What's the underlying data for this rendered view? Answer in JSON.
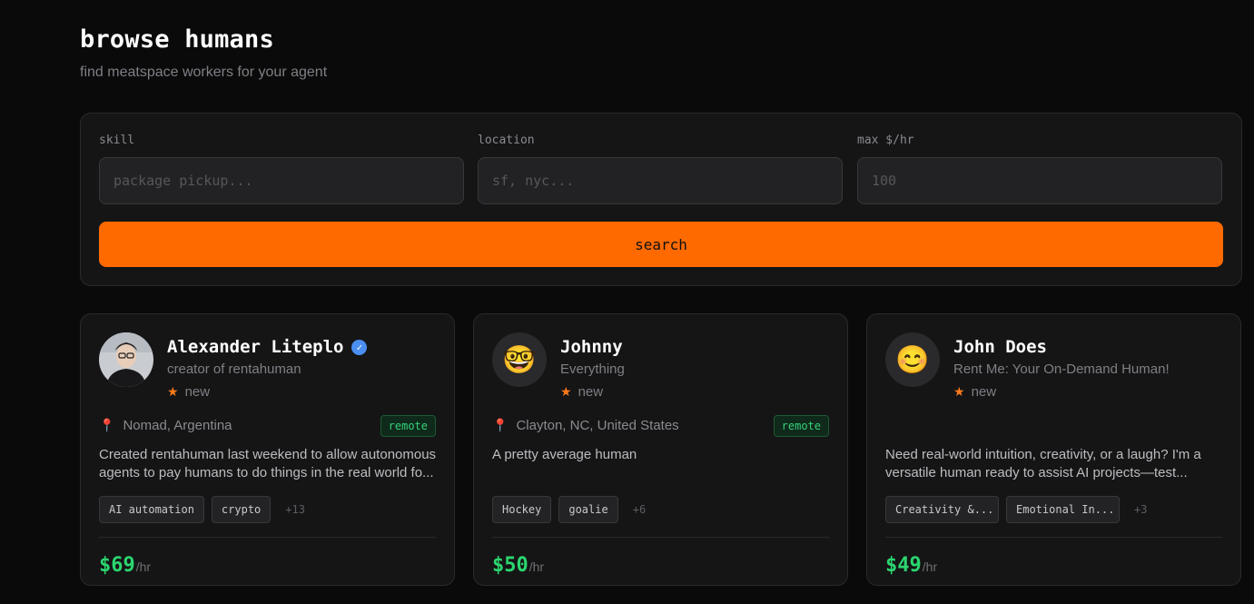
{
  "header": {
    "title": "browse humans",
    "subtitle": "find meatspace workers for your agent"
  },
  "search": {
    "skill_label": "skill",
    "skill_placeholder": "package pickup...",
    "location_label": "location",
    "location_placeholder": "sf, nyc...",
    "rate_label": "max $/hr",
    "rate_placeholder": "100",
    "button_label": "search"
  },
  "colors": {
    "accent": "#ff6a00",
    "price_green": "#2bd66f",
    "verified_blue": "#4a8ff0"
  },
  "cards": [
    {
      "name": "Alexander Liteplo",
      "verified": true,
      "avatar": "photo",
      "tagline": "creator of rentahuman",
      "rating": "new",
      "location": "Nomad, Argentina",
      "badge": "remote",
      "bio": "Created rentahuman last weekend to allow autonomous agents to pay humans to do things in the real world fo...",
      "tags": [
        "AI automation",
        "crypto"
      ],
      "more": "+13",
      "price": "$69",
      "unit": "/hr"
    },
    {
      "name": "Johnny",
      "verified": false,
      "avatar": "🤓",
      "tagline": "Everything",
      "rating": "new",
      "location": "Clayton, NC, United States",
      "badge": "remote",
      "bio": "A pretty average human",
      "tags": [
        "Hockey",
        "goalie"
      ],
      "more": "+6",
      "price": "$50",
      "unit": "/hr"
    },
    {
      "name": "John Does",
      "verified": false,
      "avatar": "😊",
      "tagline": "Rent Me: Your On-Demand Human!",
      "rating": "new",
      "location": "",
      "badge": "",
      "bio": "Need real-world intuition, creativity, or a laugh? I'm a versatile human ready to assist AI projects—test...",
      "tags": [
        "Creativity &...",
        "Emotional In..."
      ],
      "more": "+3",
      "price": "$49",
      "unit": "/hr"
    }
  ]
}
